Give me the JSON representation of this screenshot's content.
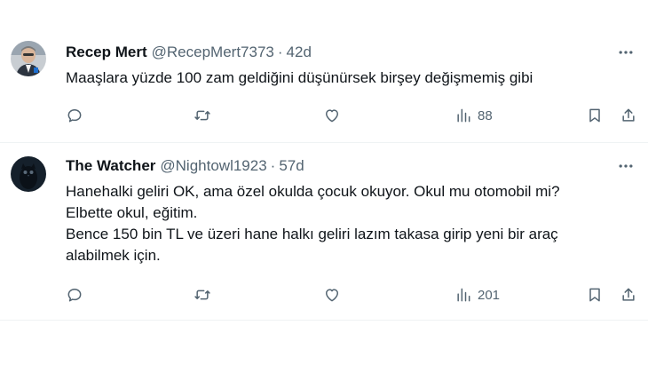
{
  "tweets": [
    {
      "display_name": "Recep Mert",
      "handle": "@RecepMert7373",
      "separator": "·",
      "age": "42d",
      "lines": [
        "Maaşlara yüzde 100 zam geldiğini düşünürsek birşey değişmemiş gibi"
      ],
      "views": "88",
      "avatar": "photo-avatar"
    },
    {
      "display_name": "The Watcher",
      "handle": "@Nightowl1923",
      "separator": "·",
      "age": "57d",
      "lines": [
        "Hanehalki geliri OK, ama özel okulda çocuk okuyor. Okul mu otomobil mi?",
        "Elbette okul, eğitim.",
        "Bence 150 bin TL ve üzeri hane halkı geliri lazım takasa girip yeni bir araç",
        "alabilmek için."
      ],
      "views": "201",
      "avatar": "dark-owl-avatar"
    }
  ],
  "icons": {
    "reply": "reply-icon",
    "retweet": "retweet-icon",
    "like": "like-icon",
    "views": "views-icon",
    "bookmark": "bookmark-icon",
    "share": "share-icon",
    "more": "more-icon"
  },
  "colors": {
    "text": "#0f1419",
    "secondary": "#536471",
    "divider": "#eff3f4"
  }
}
